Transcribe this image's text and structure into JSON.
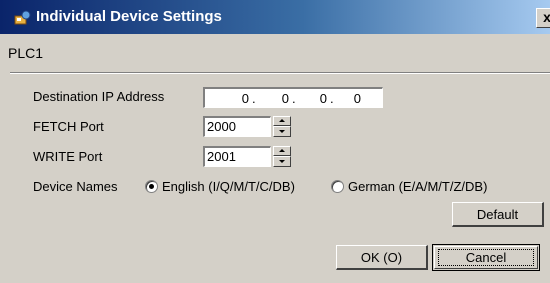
{
  "window": {
    "title": "Individual Device Settings",
    "close_glyph": "x",
    "device_name": "PLC1"
  },
  "form": {
    "ip_label": "Destination IP Address",
    "ip_octets": [
      "0",
      "0",
      "0",
      "0"
    ],
    "ip_sep": ".",
    "fetch_label": "FETCH Port",
    "fetch_value": "2000",
    "write_label": "WRITE Port",
    "write_value": "2001",
    "device_names_label": "Device Names",
    "radio_english": "English (I/Q/M/T/C/DB)",
    "radio_german": "German (E/A/M/T/Z/DB)",
    "selected_device_names": "English"
  },
  "buttons": {
    "default": "Default",
    "ok": "OK (O)",
    "cancel": "Cancel"
  }
}
